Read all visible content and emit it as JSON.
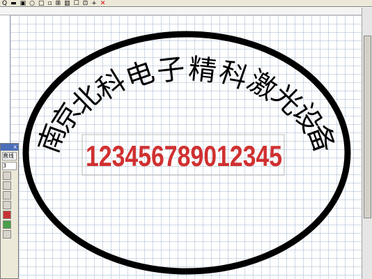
{
  "toolbar": {
    "items": [
      {
        "label": "Q",
        "name": "zoom-icon"
      },
      {
        "label": "▬",
        "name": "rect-icon"
      },
      {
        "label": "▣",
        "name": "frame-icon"
      },
      {
        "label": "○",
        "name": "ellipse-icon"
      },
      {
        "label": "□",
        "name": "square-icon"
      },
      {
        "label": "▫",
        "name": "box-icon"
      },
      {
        "label": "⊞",
        "name": "grid-icon"
      },
      {
        "label": "▥",
        "name": "fill-icon"
      },
      {
        "label": "☐",
        "name": "select-icon"
      },
      {
        "label": "⊡",
        "name": "align-icon"
      },
      {
        "label": "+",
        "name": "add-icon"
      }
    ],
    "close_label": "✕"
  },
  "panel": {
    "title": "x",
    "label": "直线",
    "value": "3"
  },
  "stamp": {
    "arc_text": "南京北科电子精科激光设备",
    "serial": "12345678901234​5",
    "border_color": "#000000",
    "serial_color": "#d03030"
  }
}
